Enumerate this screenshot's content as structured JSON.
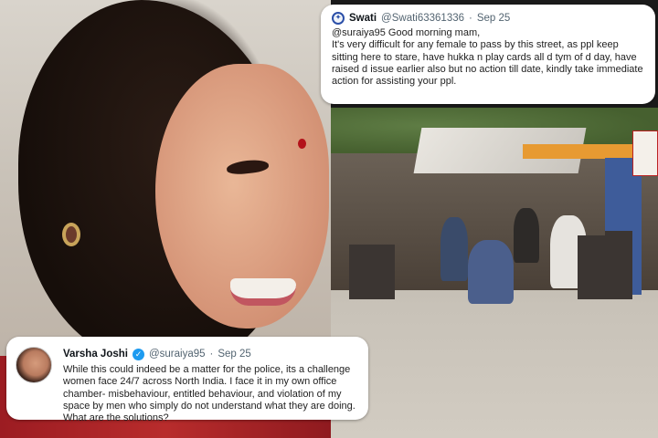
{
  "tweet_top": {
    "name": "Swati",
    "handle": "@Swati63361336",
    "separator": "·",
    "date": "Sep 25",
    "text": "@suraiya95 Good morning mam,\nIt's very difficult for any female to pass by this street, as ppl keep sitting here to stare, have hukka n play cards all d tym of d day, have raised d issue earlier also but no action till date, kindly take immediate action for assisting your ppl."
  },
  "tweet_bottom": {
    "name": "Varsha Joshi",
    "handle": "@suraiya95",
    "separator": "·",
    "date": "Sep 25",
    "text": "While this could indeed be a matter for the police, its a challenge women face 24/7 across North India. I face it in my own office chamber- misbehaviour, entitled behaviour, and violation of my space by men who simply do not understand what they are doing. What are the solutions?"
  },
  "colors": {
    "verified": "#1d9bf0",
    "meta_text": "#536471",
    "card_bg": "#ffffff"
  },
  "icons": {
    "top_avatar": "circular-emblem-icon",
    "verified_badge": "check-icon"
  }
}
